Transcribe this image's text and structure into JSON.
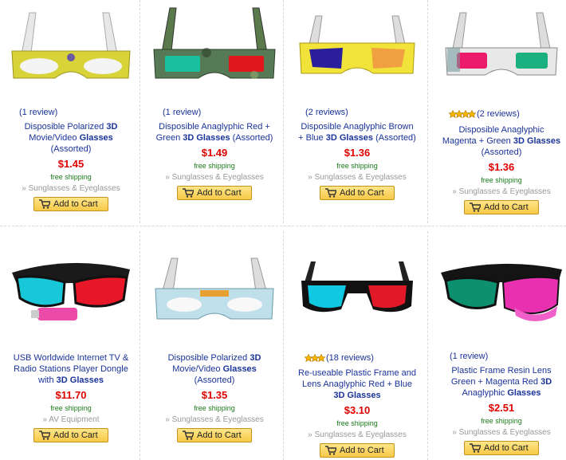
{
  "cart_label": "Add to Cart",
  "products": [
    {
      "reviews": "(1 review)",
      "stars": 0,
      "title_parts": [
        "Disposible Polarized ",
        "3D",
        " Movie/Video ",
        "Glasses",
        " (Assorted)"
      ],
      "price": "$1.45",
      "shipping": "free shipping",
      "category": "» Sunglasses & Eyeglasses",
      "image": "paper-glasses-yellow-clear"
    },
    {
      "reviews": "(1 review)",
      "stars": 0,
      "title_parts": [
        "Disposible Anaglyphic Red + Green ",
        "3D Glasses",
        " (Assorted)"
      ],
      "price": "$1.49",
      "shipping": "free shipping",
      "category": "» Sunglasses & Eyeglasses",
      "image": "paper-glasses-camo-red-green"
    },
    {
      "reviews": "(2 reviews)",
      "stars": 0,
      "title_parts": [
        "Disposible Anaglyphic Brown + Blue ",
        "3D Glasses",
        " (Assorted)"
      ],
      "price": "$1.36",
      "shipping": "free shipping",
      "category": "» Sunglasses & Eyeglasses",
      "image": "paper-glasses-yellow-blue-amber"
    },
    {
      "reviews": "(2 reviews)",
      "stars": 4,
      "title_parts": [
        "Disposible Anaglyphic Magenta + Green ",
        "3D Glasses",
        " (Assorted)"
      ],
      "price": "$1.36",
      "shipping": "free shipping",
      "category": "» Sunglasses & Eyeglasses",
      "image": "paper-glasses-magenta-green"
    },
    {
      "reviews": "",
      "stars": 0,
      "title_parts": [
        "USB Worldwide Internet TV & Radio Stations Player Dongle with ",
        "3D Glasses",
        ""
      ],
      "price": "$11.70",
      "shipping": "free shipping",
      "category": "» AV Equipment",
      "image": "plastic-glasses-cyan-red-usb"
    },
    {
      "reviews": "",
      "stars": 0,
      "title_parts": [
        "Disposible Polarized ",
        "3D",
        " Movie/Video ",
        "Glasses",
        " (Assorted)"
      ],
      "price": "$1.35",
      "shipping": "free shipping",
      "category": "» Sunglasses & Eyeglasses",
      "image": "paper-glasses-printed"
    },
    {
      "reviews": "(18 reviews)",
      "stars": 3,
      "title_parts": [
        "Re-useable Plastic Frame and Lens Anaglyphic Red + Blue ",
        "3D Glasses",
        ""
      ],
      "price": "$3.10",
      "shipping": "free shipping",
      "category": "» Sunglasses & Eyeglasses",
      "image": "plastic-glasses-cyan-red"
    },
    {
      "reviews": "(1 review)",
      "stars": 0,
      "title_parts": [
        "Plastic Frame Resin Lens Green + Magenta Red ",
        "3D",
        " Anaglyphic ",
        "Glasses",
        ""
      ],
      "price": "$2.51",
      "shipping": "free shipping",
      "category": "» Sunglasses & Eyeglasses",
      "image": "sport-glasses-green-magenta"
    }
  ]
}
